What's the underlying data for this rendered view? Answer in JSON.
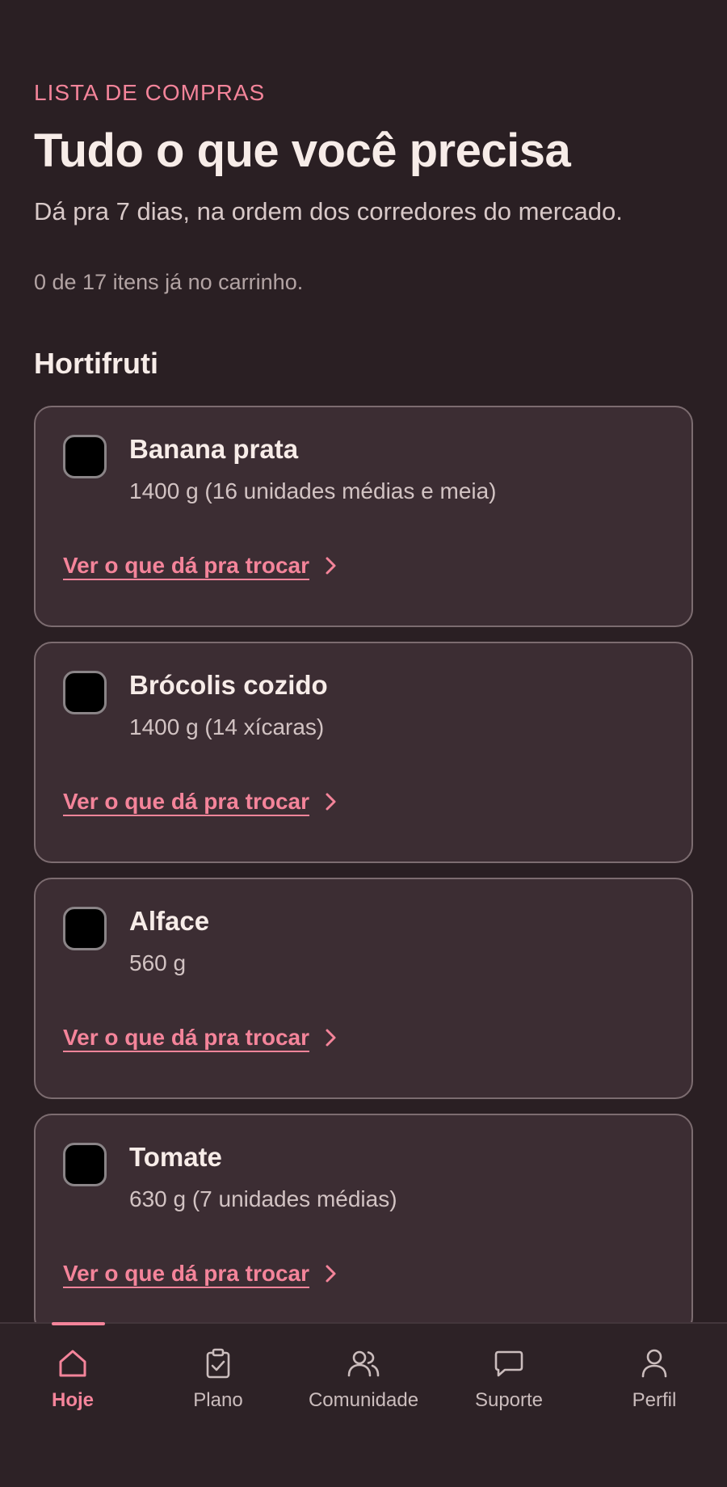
{
  "header": {
    "eyebrow": "LISTA DE COMPRAS",
    "title": "Tudo o que você precisa",
    "subtitle": "Dá pra 7 dias, na ordem dos corredores do mercado.",
    "progress": "0 de 17 itens já no carrinho."
  },
  "section": {
    "title": "Hortifruti"
  },
  "items": [
    {
      "name": "Banana prata",
      "quantity": "1400 g (16 unidades médias e meia)",
      "checked": false,
      "swap_label": "Ver o que dá pra trocar"
    },
    {
      "name": "Brócolis cozido",
      "quantity": "1400 g (14 xícaras)",
      "checked": false,
      "swap_label": "Ver o que dá pra trocar"
    },
    {
      "name": "Alface",
      "quantity": "560 g",
      "checked": false,
      "swap_label": "Ver o que dá pra trocar"
    },
    {
      "name": "Tomate",
      "quantity": "630 g (7 unidades médias)",
      "checked": false,
      "swap_label": "Ver o que dá pra trocar"
    }
  ],
  "tabbar": {
    "tabs": [
      {
        "label": "Hoje",
        "icon": "home-icon",
        "active": true
      },
      {
        "label": "Plano",
        "icon": "clipboard-check-icon",
        "active": false
      },
      {
        "label": "Comunidade",
        "icon": "users-icon",
        "active": false
      },
      {
        "label": "Suporte",
        "icon": "chat-bubble-icon",
        "active": false
      },
      {
        "label": "Perfil",
        "icon": "user-icon",
        "active": false
      }
    ]
  },
  "colors": {
    "background": "#2a1f23",
    "card": "#3c2d33",
    "accent": "#f4849a",
    "text": "#f7ece8"
  }
}
